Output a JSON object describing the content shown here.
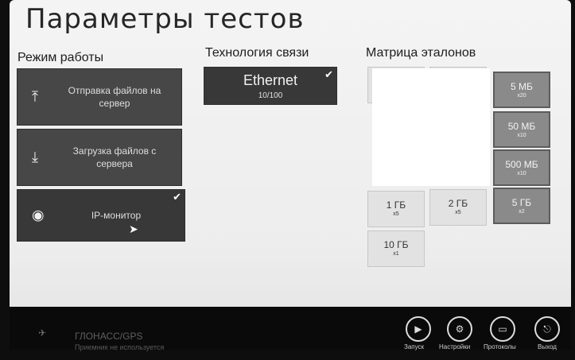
{
  "page": {
    "title": "Параметры тестов"
  },
  "mode": {
    "title": "Режим работы",
    "items": [
      {
        "label": "Отправка файлов на сервер",
        "icon": "upload-icon",
        "selected": false
      },
      {
        "label": "Загрузка файлов с сервера",
        "icon": "download-icon",
        "selected": false
      },
      {
        "label": "IP-монитор",
        "icon": "eye-icon",
        "selected": true
      }
    ]
  },
  "tech": {
    "title": "Технология связи",
    "main": "Ethernet",
    "sub": "10/100",
    "selected": true
  },
  "matrix": {
    "title": "Матрица эталонов",
    "tiles": [
      {
        "value": "5 МБ",
        "mult": "x20"
      },
      {
        "value": "50 МБ",
        "mult": "x10"
      },
      {
        "value": "500 МБ",
        "mult": "x10"
      },
      {
        "value": "1 ГБ",
        "mult": "x5"
      },
      {
        "value": "2 ГБ",
        "mult": "x5"
      },
      {
        "value": "5 ГБ",
        "mult": "x2"
      },
      {
        "value": "10 ГБ",
        "mult": "x1"
      }
    ]
  },
  "footer": {
    "gps_title": "ГЛОНАСС/GPS",
    "gps_status": "Приемник не используется",
    "buttons": [
      {
        "label": "Запуск",
        "icon": "play-icon"
      },
      {
        "label": "Настройки",
        "icon": "settings-icon"
      },
      {
        "label": "Протоколы",
        "icon": "folder-icon"
      },
      {
        "label": "Выход",
        "icon": "exit-icon"
      }
    ]
  },
  "colors": {
    "tile_dark": "#474747",
    "tile_selected": "#383838",
    "matrix_dark": "#8a8a8a",
    "matrix_light": "#e2e2e2",
    "background": "#f0f0f0"
  }
}
